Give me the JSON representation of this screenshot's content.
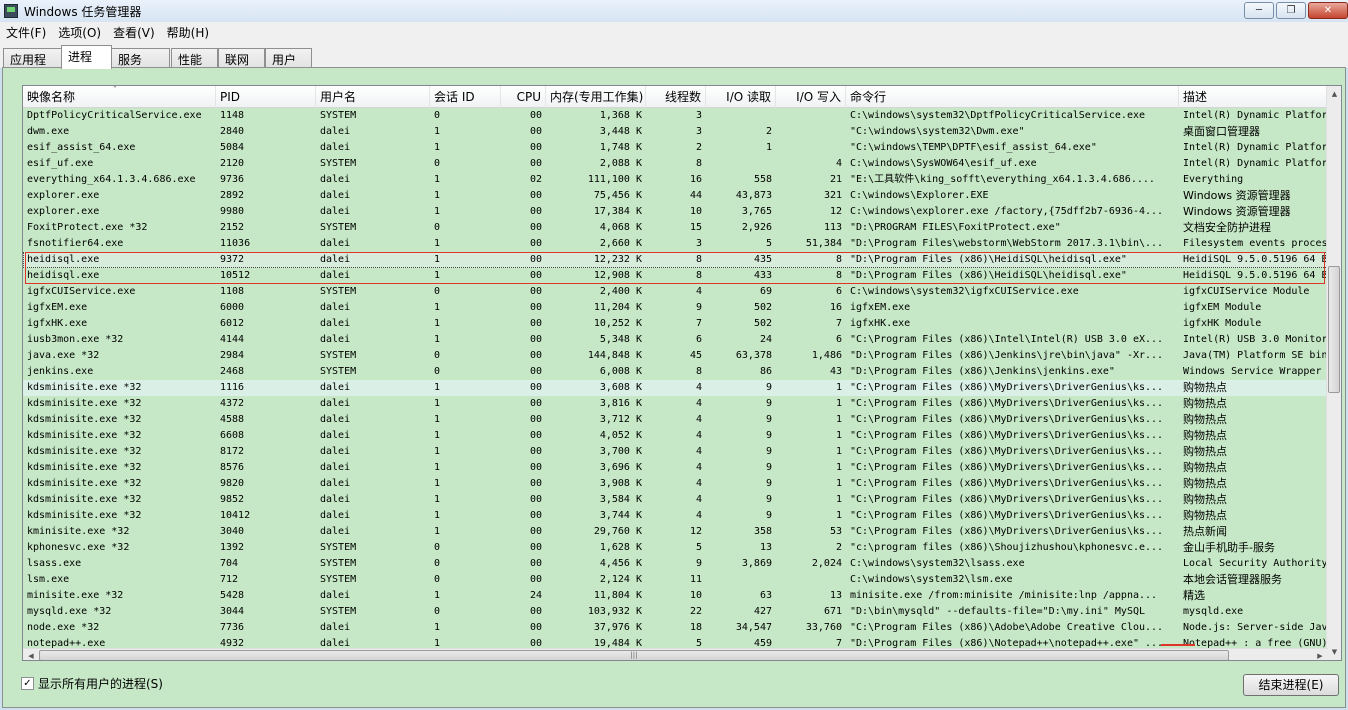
{
  "window": {
    "title": "Windows 任务管理器",
    "minimize_icon": "minimize-icon",
    "maximize_icon": "maximize-icon",
    "close_icon": "close-icon"
  },
  "menu": [
    "文件(F)",
    "选项(O)",
    "查看(V)",
    "帮助(H)"
  ],
  "tabs": [
    "应用程序",
    "进程",
    "服务",
    "性能",
    "联网",
    "用户"
  ],
  "active_tab": "进程",
  "columns": [
    "映像名称",
    "PID",
    "用户名",
    "会话 ID",
    "CPU",
    "内存(专用工作集)",
    "线程数",
    "I/O 读取",
    "I/O 写入",
    "命令行",
    "描述"
  ],
  "rows": [
    [
      "DptfPolicyCriticalService.exe",
      "1148",
      "SYSTEM",
      "0",
      "00",
      "1,368 K",
      "3",
      "",
      "",
      "C:\\windows\\system32\\DptfPolicyCriticalService.exe",
      "Intel(R) Dynamic Platfor"
    ],
    [
      "dwm.exe",
      "2840",
      "dalei",
      "1",
      "00",
      "3,448 K",
      "3",
      "2",
      "",
      "\"C:\\windows\\system32\\Dwm.exe\"",
      "桌面窗口管理器"
    ],
    [
      "esif_assist_64.exe",
      "5084",
      "dalei",
      "1",
      "00",
      "1,748 K",
      "2",
      "1",
      "",
      "\"C:\\windows\\TEMP\\DPTF\\esif_assist_64.exe\"",
      "Intel(R) Dynamic Platfor"
    ],
    [
      "esif_uf.exe",
      "2120",
      "SYSTEM",
      "0",
      "00",
      "2,088 K",
      "8",
      "",
      "4",
      "C:\\windows\\SysWOW64\\esif_uf.exe",
      "Intel(R) Dynamic Platfor"
    ],
    [
      "everything_x64.1.3.4.686.exe",
      "9736",
      "dalei",
      "1",
      "02",
      "111,100 K",
      "16",
      "558",
      "21",
      "\"E:\\工具软件\\king_sofft\\everything_x64.1.3.4.686....",
      "Everything"
    ],
    [
      "explorer.exe",
      "2892",
      "dalei",
      "1",
      "00",
      "75,456 K",
      "44",
      "43,873",
      "321",
      "C:\\windows\\Explorer.EXE",
      "Windows 资源管理器"
    ],
    [
      "explorer.exe",
      "9980",
      "dalei",
      "1",
      "00",
      "17,384 K",
      "10",
      "3,765",
      "12",
      "C:\\windows\\explorer.exe /factory,{75dff2b7-6936-4...",
      "Windows 资源管理器"
    ],
    [
      "FoxitProtect.exe *32",
      "2152",
      "SYSTEM",
      "0",
      "00",
      "4,068 K",
      "15",
      "2,926",
      "113",
      "\"D:\\PROGRAM FILES\\FoxitProtect.exe\"",
      "文档安全防护进程"
    ],
    [
      "fsnotifier64.exe",
      "11036",
      "dalei",
      "1",
      "00",
      "2,660 K",
      "3",
      "5",
      "51,384",
      "\"D:\\Program Files\\webstorm\\WebStorm 2017.3.1\\bin\\...",
      "Filesystem events proces"
    ],
    [
      "heidisql.exe",
      "9372",
      "dalei",
      "1",
      "00",
      "12,232 K",
      "8",
      "435",
      "8",
      "\"D:\\Program Files (x86)\\HeidiSQL\\heidisql.exe\"",
      "HeidiSQL 9.5.0.5196 64 B"
    ],
    [
      "heidisql.exe",
      "10512",
      "dalei",
      "1",
      "00",
      "12,908 K",
      "8",
      "433",
      "8",
      "\"D:\\Program Files (x86)\\HeidiSQL\\heidisql.exe\"",
      "HeidiSQL 9.5.0.5196 64 B"
    ],
    [
      "igfxCUIService.exe",
      "1108",
      "SYSTEM",
      "0",
      "00",
      "2,400 K",
      "4",
      "69",
      "6",
      "C:\\windows\\system32\\igfxCUIService.exe",
      "igfxCUIService Module"
    ],
    [
      "igfxEM.exe",
      "6000",
      "dalei",
      "1",
      "00",
      "11,204 K",
      "9",
      "502",
      "16",
      "igfxEM.exe",
      "igfxEM Module"
    ],
    [
      "igfxHK.exe",
      "6012",
      "dalei",
      "1",
      "00",
      "10,252 K",
      "7",
      "502",
      "7",
      "igfxHK.exe",
      "igfxHK Module"
    ],
    [
      "iusb3mon.exe *32",
      "4144",
      "dalei",
      "1",
      "00",
      "5,348 K",
      "6",
      "24",
      "6",
      "\"C:\\Program Files (x86)\\Intel\\Intel(R) USB 3.0 eX...",
      "Intel(R) USB 3.0 Monitor"
    ],
    [
      "java.exe *32",
      "2984",
      "SYSTEM",
      "0",
      "00",
      "144,848 K",
      "45",
      "63,378",
      "1,486",
      "\"D:\\Program Files (x86)\\Jenkins\\jre\\bin\\java\" -Xr...",
      "Java(TM) Platform SE bin"
    ],
    [
      "jenkins.exe",
      "2468",
      "SYSTEM",
      "0",
      "00",
      "6,008 K",
      "8",
      "86",
      "43",
      "\"D:\\Program Files (x86)\\Jenkins\\jenkins.exe\"",
      "Windows Service Wrapper"
    ],
    [
      "kdsminisite.exe *32",
      "1116",
      "dalei",
      "1",
      "00",
      "3,608 K",
      "4",
      "9",
      "1",
      "\"C:\\Program Files (x86)\\MyDrivers\\DriverGenius\\ks...",
      "购物热点"
    ],
    [
      "kdsminisite.exe *32",
      "4372",
      "dalei",
      "1",
      "00",
      "3,816 K",
      "4",
      "9",
      "1",
      "\"C:\\Program Files (x86)\\MyDrivers\\DriverGenius\\ks...",
      "购物热点"
    ],
    [
      "kdsminisite.exe *32",
      "4588",
      "dalei",
      "1",
      "00",
      "3,712 K",
      "4",
      "9",
      "1",
      "\"C:\\Program Files (x86)\\MyDrivers\\DriverGenius\\ks...",
      "购物热点"
    ],
    [
      "kdsminisite.exe *32",
      "6608",
      "dalei",
      "1",
      "00",
      "4,052 K",
      "4",
      "9",
      "1",
      "\"C:\\Program Files (x86)\\MyDrivers\\DriverGenius\\ks...",
      "购物热点"
    ],
    [
      "kdsminisite.exe *32",
      "8172",
      "dalei",
      "1",
      "00",
      "3,700 K",
      "4",
      "9",
      "1",
      "\"C:\\Program Files (x86)\\MyDrivers\\DriverGenius\\ks...",
      "购物热点"
    ],
    [
      "kdsminisite.exe *32",
      "8576",
      "dalei",
      "1",
      "00",
      "3,696 K",
      "4",
      "9",
      "1",
      "\"C:\\Program Files (x86)\\MyDrivers\\DriverGenius\\ks...",
      "购物热点"
    ],
    [
      "kdsminisite.exe *32",
      "9820",
      "dalei",
      "1",
      "00",
      "3,908 K",
      "4",
      "9",
      "1",
      "\"C:\\Program Files (x86)\\MyDrivers\\DriverGenius\\ks...",
      "购物热点"
    ],
    [
      "kdsminisite.exe *32",
      "9852",
      "dalei",
      "1",
      "00",
      "3,584 K",
      "4",
      "9",
      "1",
      "\"C:\\Program Files (x86)\\MyDrivers\\DriverGenius\\ks...",
      "购物热点"
    ],
    [
      "kdsminisite.exe *32",
      "10412",
      "dalei",
      "1",
      "00",
      "3,744 K",
      "4",
      "9",
      "1",
      "\"C:\\Program Files (x86)\\MyDrivers\\DriverGenius\\ks...",
      "购物热点"
    ],
    [
      "kminisite.exe *32",
      "3040",
      "dalei",
      "1",
      "00",
      "29,760 K",
      "12",
      "358",
      "53",
      "\"C:\\Program Files (x86)\\MyDrivers\\DriverGenius\\ks...",
      "热点新闻"
    ],
    [
      "kphonesvc.exe *32",
      "1392",
      "SYSTEM",
      "0",
      "00",
      "1,628 K",
      "5",
      "13",
      "2",
      "\"c:\\program files (x86)\\Shoujizhushou\\kphonesvc.e...",
      "金山手机助手-服务"
    ],
    [
      "lsass.exe",
      "704",
      "SYSTEM",
      "0",
      "00",
      "4,456 K",
      "9",
      "3,869",
      "2,024",
      "C:\\windows\\system32\\lsass.exe",
      "Local Security Authority"
    ],
    [
      "lsm.exe",
      "712",
      "SYSTEM",
      "0",
      "00",
      "2,124 K",
      "11",
      "",
      "",
      "C:\\windows\\system32\\lsm.exe",
      "本地会话管理器服务"
    ],
    [
      "minisite.exe *32",
      "5428",
      "dalei",
      "1",
      "24",
      "11,804 K",
      "10",
      "63",
      "13",
      "minisite.exe  /from:minisite /minisite:lnp /appna...",
      "精选"
    ],
    [
      "mysqld.exe *32",
      "3044",
      "SYSTEM",
      "0",
      "00",
      "103,932 K",
      "22",
      "427",
      "671",
      "\"D:\\bin\\mysqld\" --defaults-file=\"D:\\my.ini\" MySQL",
      "mysqld.exe"
    ],
    [
      "node.exe *32",
      "7736",
      "dalei",
      "1",
      "00",
      "37,976 K",
      "18",
      "34,547",
      "33,760",
      "\"C:\\Program Files (x86)\\Adobe\\Adobe Creative Clou...",
      "Node.js: Server-side Jav"
    ],
    [
      "notepad++.exe",
      "4932",
      "dalei",
      "1",
      "00",
      "19,484 K",
      "5",
      "459",
      "7",
      "\"D:\\Program Files (x86)\\Notepad++\\notepad++.exe\" ...",
      "Notepad++ : a free (GNU)"
    ]
  ],
  "selected_row": 9,
  "hover_row": 17,
  "show_all_label": "显示所有用户的进程(S)",
  "show_all_checked": true,
  "checkbox_mark": "✓",
  "end_process_label": "结束进程(E)",
  "colors": {
    "list_bg": "#c6e8c6",
    "highlight": "#e0332a"
  }
}
